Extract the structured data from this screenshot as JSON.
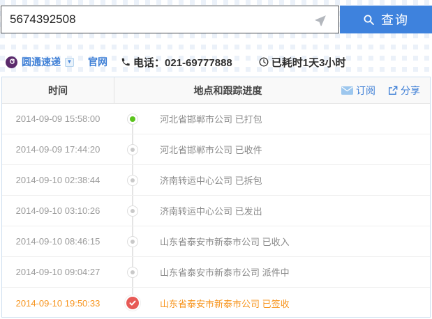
{
  "search": {
    "tracking_number": "5674392508",
    "button_label": "查询"
  },
  "courier": {
    "name": "圆通速递",
    "official_site_label": "官网",
    "phone_label": "电话：021-69777888",
    "elapsed_label": "已耗时1天3小时"
  },
  "table": {
    "headers": {
      "time": "时间",
      "progress": "地点和跟踪进度"
    },
    "actions": {
      "subscribe": "订阅",
      "share": "分享"
    },
    "rows": [
      {
        "time": "2014-09-09 15:58:00",
        "status": "河北省邯郸市公司 已打包",
        "dot": "green",
        "highlight": false
      },
      {
        "time": "2014-09-09 17:44:20",
        "status": "河北省邯郸市公司 已收件",
        "dot": "gray",
        "highlight": false
      },
      {
        "time": "2014-09-10 02:38:44",
        "status": "济南转运中心公司 已拆包",
        "dot": "gray",
        "highlight": false
      },
      {
        "time": "2014-09-10 03:10:26",
        "status": "济南转运中心公司 已发出",
        "dot": "gray",
        "highlight": false
      },
      {
        "time": "2014-09-10 08:46:15",
        "status": "山东省泰安市新泰市公司 已收入",
        "dot": "gray",
        "highlight": false
      },
      {
        "time": "2014-09-10 09:04:27",
        "status": "山东省泰安市新泰市公司 派件中",
        "dot": "gray",
        "highlight": false
      },
      {
        "time": "2014-09-10 19:50:33",
        "status": "山东省泰安市新泰市公司 已签收",
        "dot": "check",
        "highlight": true
      }
    ]
  },
  "colors": {
    "accent_blue": "#3e82dd",
    "link_blue": "#3e7fd6",
    "highlight_orange": "#f7941d",
    "delivered_red": "#e75a56",
    "active_green": "#5bc41d",
    "pattern_blue": "#ebf1f9",
    "table_border": "#cddff0"
  },
  "icons": {
    "send": "paper-plane-icon",
    "search": "magnifier-icon",
    "logo": "yto-logo",
    "dropdown": "chevron-down-icon",
    "phone": "phone-icon",
    "clock": "clock-icon",
    "subscribe": "envelope-icon",
    "share": "share-icon",
    "delivered": "check-icon"
  }
}
